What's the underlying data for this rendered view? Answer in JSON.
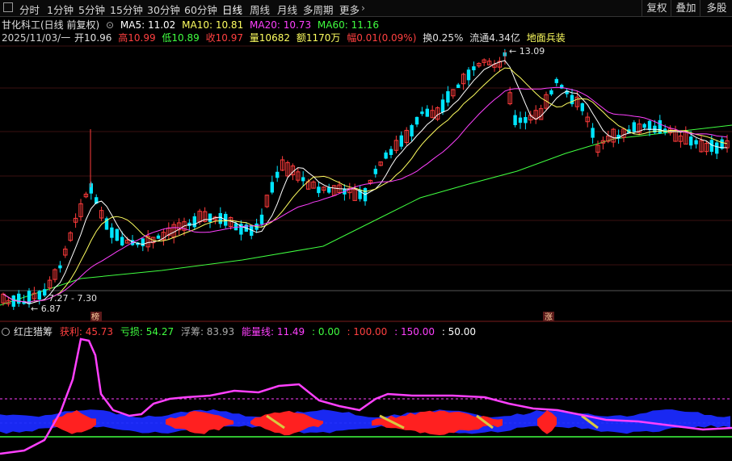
{
  "toolbar": {
    "periods": [
      "分时",
      "1分钟",
      "5分钟",
      "15分钟",
      "30分钟",
      "60分钟",
      "日线",
      "周线",
      "月线",
      "多周期",
      "更多"
    ],
    "active_period": "日线",
    "right_buttons": [
      "复权",
      "叠加",
      "多股"
    ]
  },
  "stock": {
    "name": "甘化科工(日线 前复权)",
    "ma5_label": "MA5: 11.02",
    "ma10_label": "MA10: 10.81",
    "ma20_label": "MA20: 10.73",
    "ma60_label": "MA60: 11.16",
    "date": "2025/11/03/一",
    "open": "开10.96",
    "high": "高10.99",
    "low": "低10.89",
    "close": "收10.97",
    "volume": "量10682",
    "amount": "额1170万",
    "change": "幅0.01(0.09%)",
    "turnover": "换0.25%",
    "float_cap": "流通4.34亿",
    "concept": "地面兵装",
    "peak_label": "13.09",
    "low_label": "6.87",
    "range_label": "7.27 - 7.30",
    "tag1": "榜",
    "tag2": "涨"
  },
  "indicator": {
    "name": "红庄猎筹",
    "profit": "获利: 45.73",
    "loss": "亏损: 54.27",
    "float": "浮筹: 83.93",
    "energy": "能量线: 11.49",
    "v0": ": 0.00",
    "v100": ": 100.00",
    "v150": ": 150.00",
    "v50": ": 50.00"
  },
  "colors": {
    "up": "#ff3b3b",
    "down": "#00e5ff",
    "ma5": "#ffffff",
    "ma10": "#ffff60",
    "ma20": "#ff40ff",
    "ma60": "#40ff40",
    "accent_energy": "#ff40ff"
  }
}
